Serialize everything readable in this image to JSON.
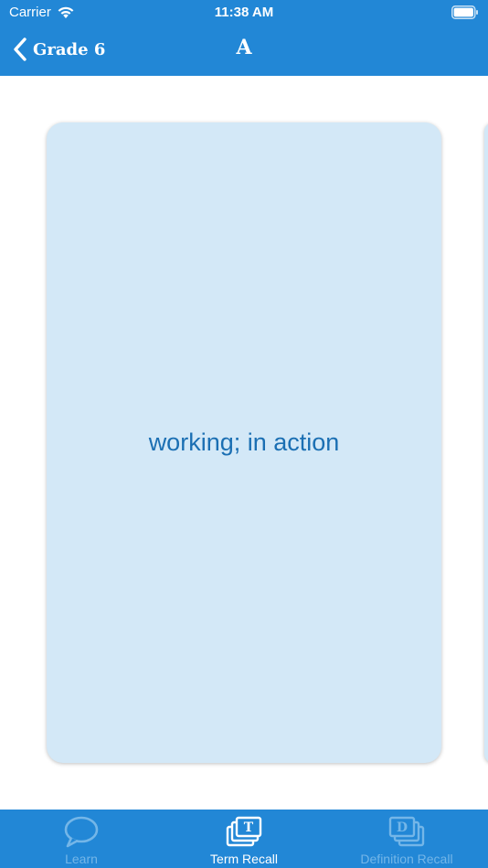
{
  "status_bar": {
    "carrier": "Carrier",
    "time": "11:38 AM"
  },
  "nav": {
    "back_label": "Grade 6",
    "title": "A"
  },
  "card": {
    "text": "working; in action"
  },
  "tabs": [
    {
      "label": "Learn",
      "icon": "speech-bubble-icon",
      "active": false
    },
    {
      "label": "Term Recall",
      "icon": "term-cards-icon",
      "active": true
    },
    {
      "label": "Definition Recall",
      "icon": "definition-cards-icon",
      "active": false
    }
  ],
  "colors": {
    "brand_blue": "#2287d6",
    "card_background": "#d3e8f7",
    "card_text": "#1b6fb3",
    "tab_inactive": "#74b6e8",
    "tab_active": "#ffffff"
  }
}
